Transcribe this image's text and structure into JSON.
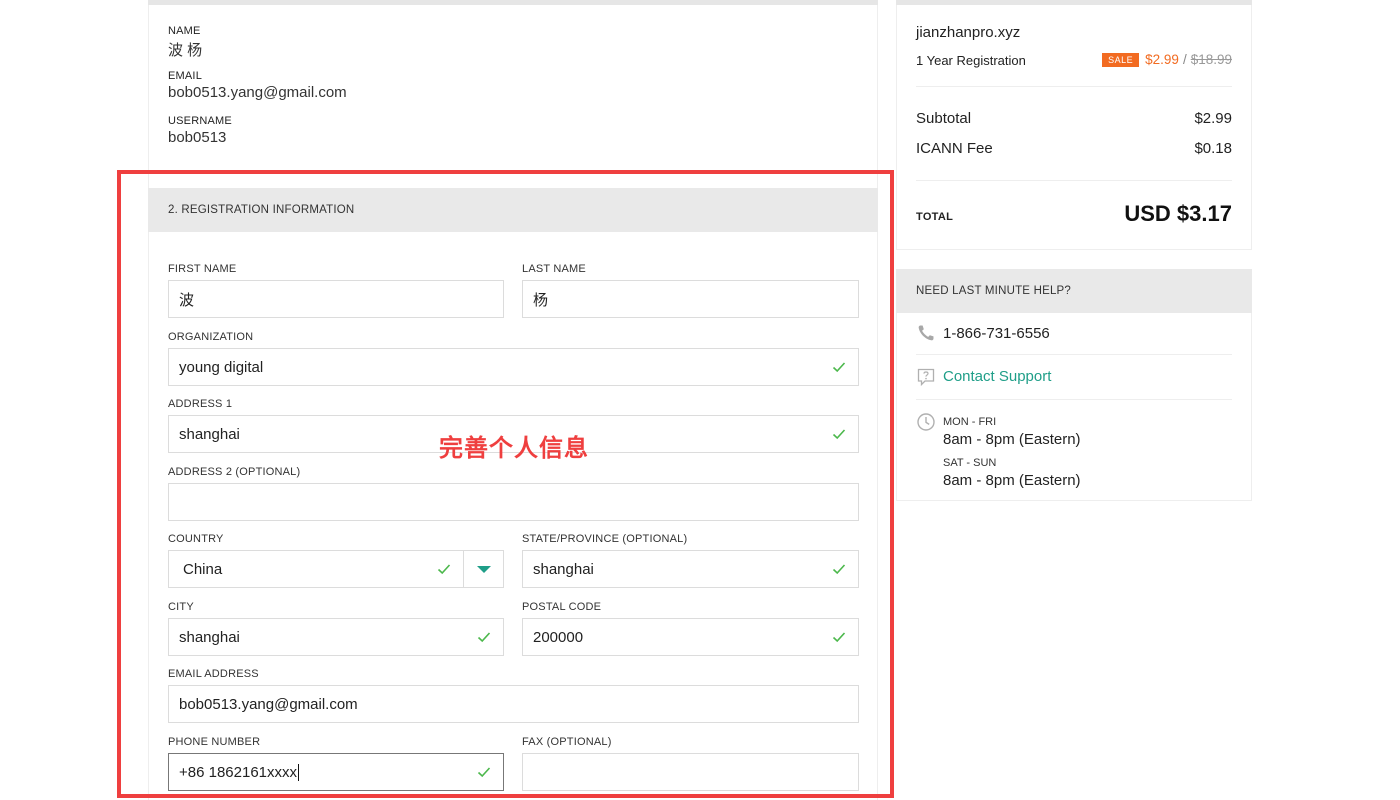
{
  "account": {
    "name_label": "NAME",
    "name_value": "波 杨",
    "email_label": "EMAIL",
    "email_value": "bob0513.yang@gmail.com",
    "username_label": "USERNAME",
    "username_value": "bob0513"
  },
  "registration": {
    "section_title": "2. REGISTRATION INFORMATION",
    "first_name_label": "FIRST NAME",
    "first_name_value": "波",
    "last_name_label": "LAST NAME",
    "last_name_value": "杨",
    "organization_label": "ORGANIZATION",
    "organization_value": "young digital",
    "address1_label": "ADDRESS 1",
    "address1_value": "shanghai",
    "address2_label": "ADDRESS 2 (OPTIONAL)",
    "address2_value": "",
    "country_label": "COUNTRY",
    "country_value": "China",
    "state_label": "STATE/PROVINCE (OPTIONAL)",
    "state_value": "shanghai",
    "city_label": "CITY",
    "city_value": "shanghai",
    "postal_label": "POSTAL CODE",
    "postal_value": "200000",
    "email_label": "EMAIL ADDRESS",
    "email_value": "bob0513.yang@gmail.com",
    "phone_label": "PHONE NUMBER",
    "phone_value": "+86 1862161xxxx",
    "fax_label": "FAX (OPTIONAL)",
    "fax_value": ""
  },
  "annotation": {
    "text": "完善个人信息",
    "color": "#ef3f3f"
  },
  "order": {
    "domain": "jianzhanpro.xyz",
    "term": "1 Year Registration",
    "sale_badge": "SALE",
    "sale_price": "$2.99",
    "price_separator": "/",
    "original_price": "$18.99",
    "subtotal_label": "Subtotal",
    "subtotal_value": "$2.99",
    "icann_label": "ICANN Fee",
    "icann_value": "$0.18",
    "total_label": "TOTAL",
    "total_value": "USD $3.17"
  },
  "help": {
    "title": "NEED LAST MINUTE HELP?",
    "phone": "1-866-731-6556",
    "support_link": "Contact Support",
    "weekday_label": "MON - FRI",
    "weekday_hours": "8am - 8pm (Eastern)",
    "weekend_label": "SAT - SUN",
    "weekend_hours": "8am - 8pm (Eastern)"
  },
  "colors": {
    "accent": "#1f9e88",
    "sale": "#f26b21",
    "check": "#4cb84c"
  }
}
